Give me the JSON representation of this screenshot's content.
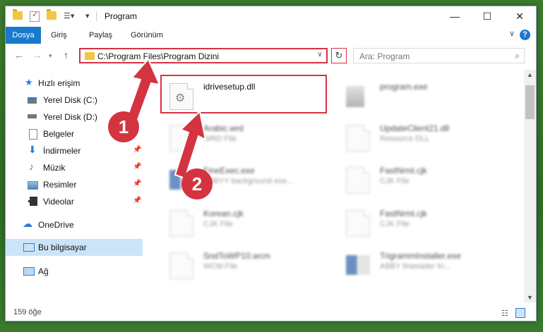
{
  "window": {
    "title": "Program",
    "controls": {
      "minimize": "—",
      "maximize": "☐",
      "close": "✕"
    }
  },
  "ribbon": {
    "tabs": [
      "Dosya",
      "Giriş",
      "Paylaş",
      "Görünüm"
    ],
    "help": "?"
  },
  "nav": {
    "address": "C:\\Program Files\\Program Dizini",
    "search_placeholder": "Ara: Program"
  },
  "sidebar": {
    "items": [
      {
        "label": "Hızlı erişim",
        "icon": "star-icon"
      },
      {
        "label": "Yerel Disk (C:)",
        "icon": "drive-icon"
      },
      {
        "label": "Yerel Disk (D:)",
        "icon": "drive-icon"
      },
      {
        "label": "Belgeler",
        "icon": "documents-icon"
      },
      {
        "label": "İndirmeler",
        "icon": "download-icon"
      },
      {
        "label": "Müzik",
        "icon": "music-icon"
      },
      {
        "label": "Resimler",
        "icon": "pictures-icon"
      },
      {
        "label": "Videolar",
        "icon": "videos-icon"
      },
      {
        "label": "OneDrive",
        "icon": "cloud-icon"
      },
      {
        "label": "Bu bilgisayar",
        "icon": "computer-icon"
      },
      {
        "label": "Ağ",
        "icon": "network-icon"
      }
    ]
  },
  "files": [
    {
      "name": "idrivesetup.dll",
      "type": ""
    },
    {
      "name": "program.exe",
      "type": ""
    },
    {
      "name": "Arabic.wrd",
      "type": "WRD File"
    },
    {
      "name": "UpdateClient21.dll",
      "type": "Resource DLL"
    },
    {
      "name": "FineExec.exe",
      "type": "ABBYY background exe..."
    },
    {
      "name": "FastNrml.cjk",
      "type": "CJK File"
    },
    {
      "name": "Korean.cjk",
      "type": "CJK File"
    },
    {
      "name": "FastNrml.cjk",
      "type": "CJK File"
    },
    {
      "name": "SndToWP10.wcm",
      "type": "WCM File"
    },
    {
      "name": "TrigrammInstaller.exe",
      "type": "ABBY fineeader tri..."
    }
  ],
  "status": {
    "count": "159 öğe"
  },
  "callouts": {
    "one": "1",
    "two": "2"
  },
  "colors": {
    "accent": "#1979ca",
    "highlight": "#d43340",
    "selected": "#cce4f7"
  }
}
